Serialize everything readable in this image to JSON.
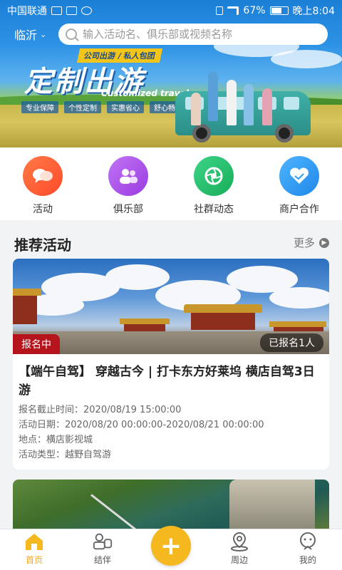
{
  "status_bar": {
    "carrier": "中国联通",
    "battery": "67%",
    "time": "晚上8:04"
  },
  "header": {
    "city": "临沂",
    "search_placeholder": "输入活动名、俱乐部或视频名称"
  },
  "banner": {
    "tag": "公司出游 / 私人包团",
    "title": "定制出游",
    "subtitle": "Customized travel",
    "features": [
      "专业保障",
      "个性定制",
      "实惠省心",
      "舒心畅游"
    ]
  },
  "quick_nav": [
    {
      "label": "活动",
      "icon": "chat-bubbles-icon",
      "color": "#ff5a36"
    },
    {
      "label": "俱乐部",
      "icon": "people-icon",
      "color": "#a54de8"
    },
    {
      "label": "社群动态",
      "icon": "aperture-icon",
      "color": "#25c26a"
    },
    {
      "label": "商户合作",
      "icon": "heart-handshake-icon",
      "color": "#2a9cf2"
    }
  ],
  "section": {
    "title": "推荐活动",
    "more": "更多"
  },
  "activity": {
    "status": "报名中",
    "count": "已报名1人",
    "title": "【端午自驾】 穿越古今 | 打卡东方好莱坞 横店自驾3日游",
    "deadline": "报名截止时间：2020/08/19 15:00:00",
    "dates": "活动日期：2020/08/20 00:00:00-2020/08/21 00:00:00",
    "location": "地点：横店影视城",
    "type": "活动类型：越野自驾游"
  },
  "tabbar": [
    {
      "label": "首页",
      "icon": "home-icon",
      "active": true
    },
    {
      "label": "结伴",
      "icon": "companion-icon",
      "active": false
    },
    {
      "label": "",
      "icon": "plus-icon",
      "active": false
    },
    {
      "label": "周边",
      "icon": "location-pin-icon",
      "active": false
    },
    {
      "label": "我的",
      "icon": "profile-icon",
      "active": false
    }
  ],
  "colors": {
    "accent": "#f5b81f",
    "status_badge": "#b5141c"
  }
}
